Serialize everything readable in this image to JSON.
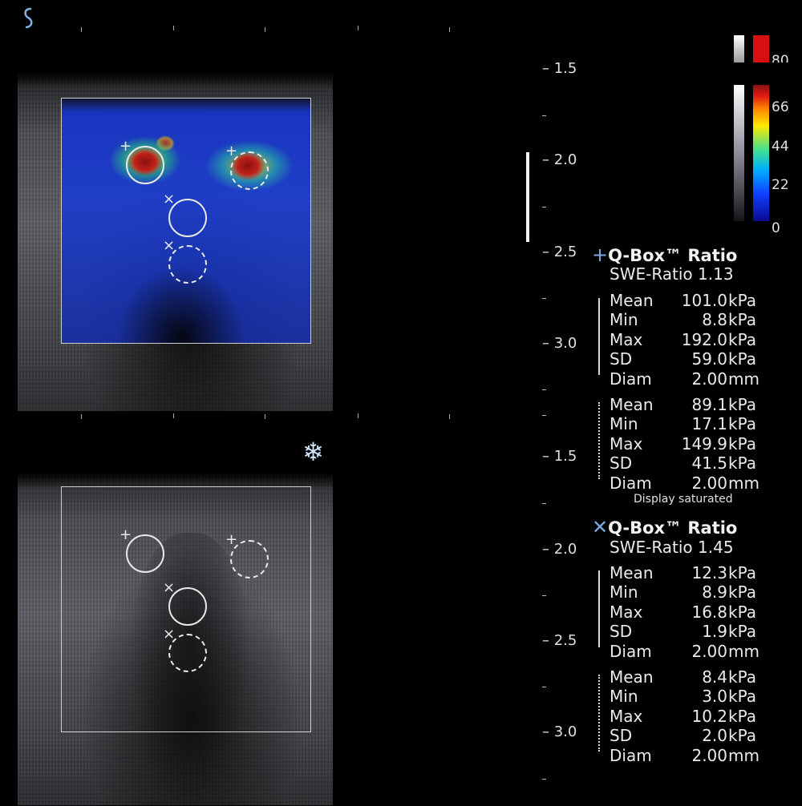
{
  "depth_scale": {
    "top_labels": [
      "1.5",
      "2.0",
      "2.5",
      "3.0"
    ],
    "bottom_labels": [
      "1.5",
      "2.0",
      "2.5",
      "3.0"
    ]
  },
  "colorbar": {
    "labels": [
      "66",
      "44",
      "22",
      "0"
    ],
    "top_label_partial": "80"
  },
  "qbox_plus": {
    "symbol": "+",
    "title": "Q-Box™ Ratio",
    "swe_ratio": "SWE-Ratio 1.13",
    "solid_group": [
      {
        "label": "Mean",
        "value": "101.0",
        "unit": "kPa"
      },
      {
        "label": "Min",
        "value": "8.8",
        "unit": "kPa"
      },
      {
        "label": "Max",
        "value": "192.0",
        "unit": "kPa"
      },
      {
        "label": "SD",
        "value": "59.0",
        "unit": "kPa"
      },
      {
        "label": "Diam",
        "value": "2.00",
        "unit": "mm"
      }
    ],
    "dotted_group": [
      {
        "label": "Mean",
        "value": "89.1",
        "unit": "kPa"
      },
      {
        "label": "Min",
        "value": "17.1",
        "unit": "kPa"
      },
      {
        "label": "Max",
        "value": "149.9",
        "unit": "kPa"
      },
      {
        "label": "SD",
        "value": "41.5",
        "unit": "kPa"
      },
      {
        "label": "Diam",
        "value": "2.00",
        "unit": "mm"
      }
    ],
    "note": "Display saturated"
  },
  "qbox_cross": {
    "symbol": "✕",
    "title": "Q-Box™ Ratio",
    "swe_ratio": "SWE-Ratio 1.45",
    "solid_group": [
      {
        "label": "Mean",
        "value": "12.3",
        "unit": "kPa"
      },
      {
        "label": "Min",
        "value": "8.9",
        "unit": "kPa"
      },
      {
        "label": "Max",
        "value": "16.8",
        "unit": "kPa"
      },
      {
        "label": "SD",
        "value": "1.9",
        "unit": "kPa"
      },
      {
        "label": "Diam",
        "value": "2.00",
        "unit": "mm"
      }
    ],
    "dotted_group": [
      {
        "label": "Mean",
        "value": "8.4",
        "unit": "kPa"
      },
      {
        "label": "Min",
        "value": "3.0",
        "unit": "kPa"
      },
      {
        "label": "Max",
        "value": "10.2",
        "unit": "kPa"
      },
      {
        "label": "SD",
        "value": "2.0",
        "unit": "kPa"
      },
      {
        "label": "Diam",
        "value": "2.00",
        "unit": "mm"
      }
    ]
  },
  "markers": {
    "plus": "+",
    "cross": "×"
  },
  "icons": {
    "logo": "supersonic-logo-icon",
    "freeze": "snowflake-freeze-icon"
  },
  "colors": {
    "accent": "#7fa9e0",
    "background": "#000000"
  }
}
